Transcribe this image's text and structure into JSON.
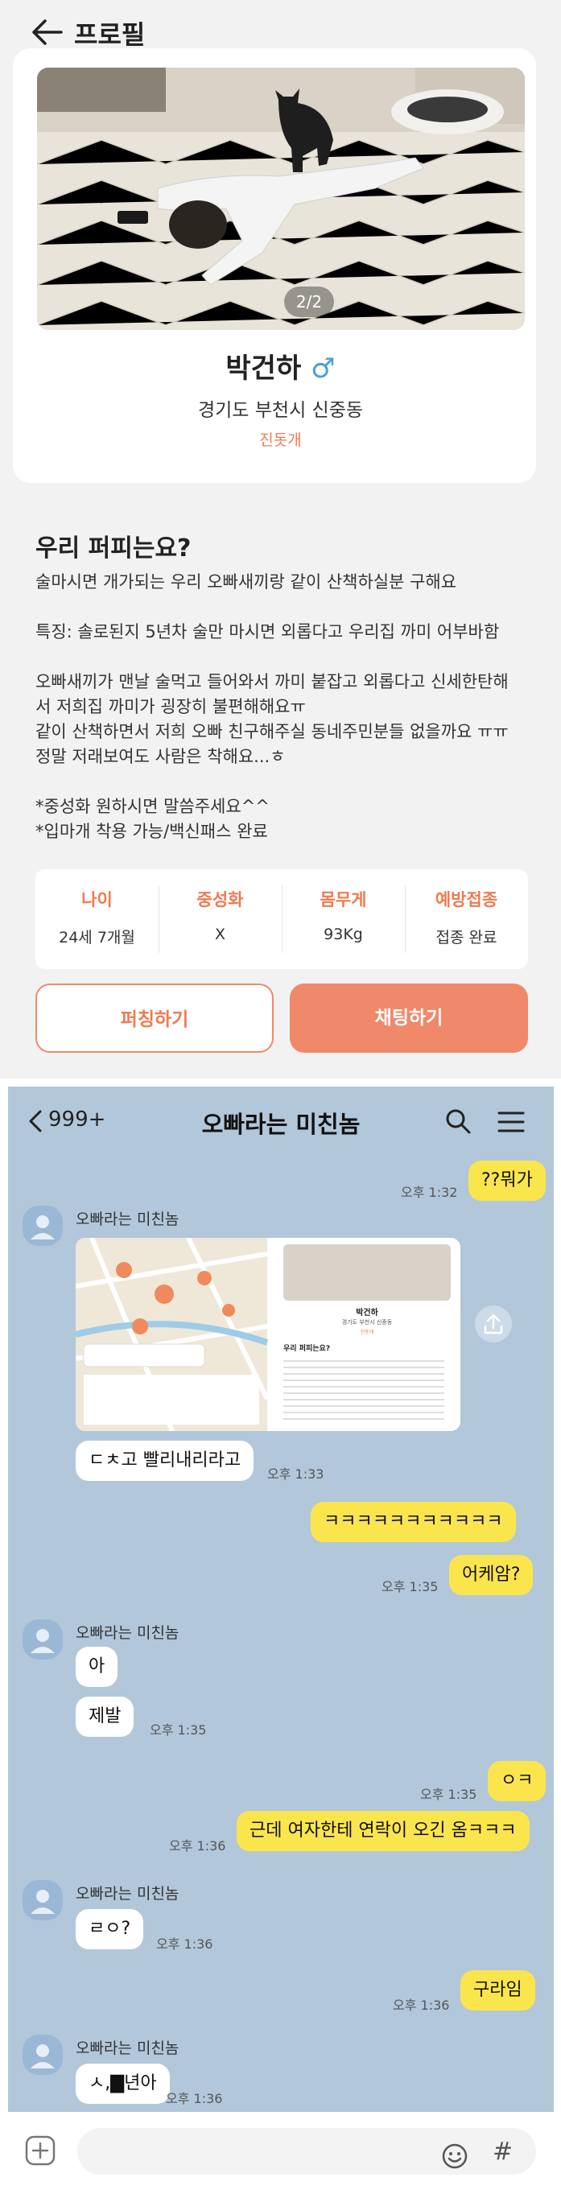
{
  "profile": {
    "header": {
      "title": "프로필"
    },
    "photo": {
      "counter": "2/2"
    },
    "name": "박건하",
    "gender_symbol": "♂",
    "location": "경기도 부천시 신중동",
    "breed": "진돗개",
    "intro": {
      "title": "우리 퍼피는요?",
      "paragraphs": [
        "술마시면 개가되는 우리 오빠새끼랑 같이 산책하실분 구해요",
        "특징: 솔로된지 5년차 술만 마시면 외롭다고 우리집 까미 어부바함",
        "오빠새끼가 맨날 술먹고 들어와서 까미 붙잡고 외롭다고 신세한탄해\n서 저희집 까미가 굉장히 불편해해요ㅠ\n같이 산책하면서 저희 오빠 친구해주실 동네주민분들 없을까요 ㅠㅠ\n정말 저래보여도 사람은 착해요...ㅎ",
        "*중성화 원하시면 말씀주세요^^\n*입마개 착용 가능/백신패스 완료"
      ]
    },
    "stats": [
      {
        "label": "나이",
        "value": "24세 7개월"
      },
      {
        "label": "중성화",
        "value": "X"
      },
      {
        "label": "몸무게",
        "value": "93Kg"
      },
      {
        "label": "예방접종",
        "value": "접종 완료"
      }
    ],
    "buttons": {
      "punch": "퍼칭하기",
      "chat": "채팅하기"
    }
  },
  "chat": {
    "header": {
      "unread_count": "999+",
      "title": "오빠라는 미친놈"
    },
    "sender_name": "오빠라는 미친놈",
    "messages": [
      {
        "text": "??뭐가",
        "time": "오후 1:32"
      },
      {
        "text": "ㄷㅊ고 빨리내리라고",
        "time": "오후 1:33"
      },
      {
        "text": "ㅋㅋㅋㅋㅋㅋㅋㅋㅋㅋㅋ",
        "time": ""
      },
      {
        "text": "어케암?",
        "time": "오후 1:35"
      },
      {
        "text": "아",
        "time": ""
      },
      {
        "text": "제발",
        "time": "오후 1:35"
      },
      {
        "text": "ㅇㅋ",
        "time": "오후 1:35"
      },
      {
        "text": "근데 여자한테 연락이 오긴 옴ㅋㅋㅋ",
        "time": "오후 1:36"
      },
      {
        "text": "ㄹㅇ?",
        "time": "오후 1:36"
      },
      {
        "text": "구라임",
        "time": "오후 1:36"
      },
      {
        "text": "ㅅ,▇년아",
        "time": "오후 1:36"
      }
    ],
    "shared_screenshot": {
      "name": "박건하",
      "location": "경기도 부천시 신중동",
      "breed": "진돗개",
      "intro_title": "우리 퍼피는요?"
    }
  },
  "colors": {
    "accent": "#f07a50",
    "chat_bg": "#b2c7da",
    "my_bubble": "#fbe54d"
  }
}
